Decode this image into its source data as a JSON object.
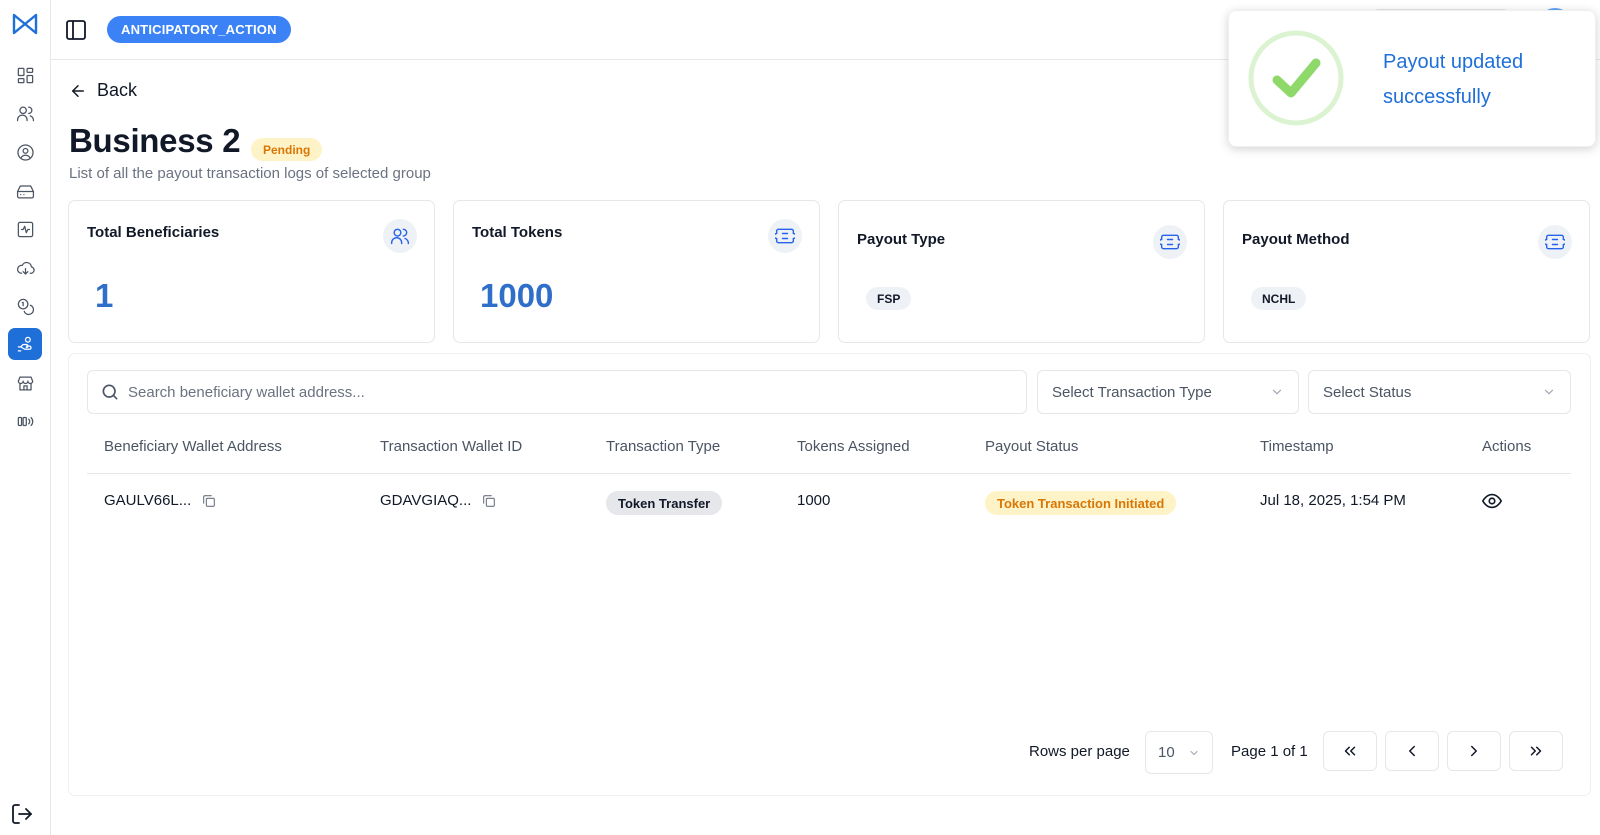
{
  "app": {
    "project_badge": "ANTICIPATORY_ACTION"
  },
  "sidebar": {
    "items": [
      {
        "icon": "dashboard-icon"
      },
      {
        "icon": "users-icon"
      },
      {
        "icon": "user-circle-icon"
      },
      {
        "icon": "inbox-icon"
      },
      {
        "icon": "activity-icon"
      },
      {
        "icon": "cloud-icon"
      },
      {
        "icon": "coins-icon"
      },
      {
        "icon": "payout-icon",
        "active": true
      },
      {
        "icon": "store-icon"
      },
      {
        "icon": "broadcast-icon"
      }
    ],
    "logout_icon": "logout-icon"
  },
  "header": {
    "back_label": "Back",
    "title": "Business 2",
    "status": "Pending",
    "subtitle": "List of all the payout transaction logs of selected group"
  },
  "cards": [
    {
      "title": "Total Beneficiaries",
      "value": "1",
      "icon": "users-icon"
    },
    {
      "title": "Total Tokens",
      "value": "1000",
      "icon": "ticket-icon"
    },
    {
      "title": "Payout Type",
      "tag": "FSP",
      "icon": "ticket-icon"
    },
    {
      "title": "Payout Method",
      "tag": "NCHL",
      "icon": "ticket-icon"
    }
  ],
  "filters": {
    "search_placeholder": "Search beneficiary wallet address...",
    "transaction_type_placeholder": "Select Transaction Type",
    "status_placeholder": "Select Status"
  },
  "table": {
    "columns": [
      "Beneficiary Wallet Address",
      "Transaction Wallet ID",
      "Transaction Type",
      "Tokens Assigned",
      "Payout Status",
      "Timestamp",
      "Actions"
    ],
    "rows": [
      {
        "beneficiary_wallet": "GAULV66L...",
        "transaction_wallet": "GDAVGIAQ...",
        "transaction_type": "Token Transfer",
        "tokens_assigned": "1000",
        "payout_status": "Token Transaction Initiated",
        "timestamp": "Jul 18, 2025, 1:54 PM"
      }
    ]
  },
  "pagination": {
    "rows_per_page_label": "Rows per page",
    "rows_per_page": "10",
    "page_info": "Page 1 of 1"
  },
  "toast": {
    "message": "Payout updated successfully",
    "icon": "check-circle-icon"
  },
  "colors": {
    "accent": "#1f6fd8",
    "badge": "#3b82f6",
    "pending_bg": "#fef3c7",
    "pending_text": "#d97706",
    "success": "#8fd96b"
  }
}
